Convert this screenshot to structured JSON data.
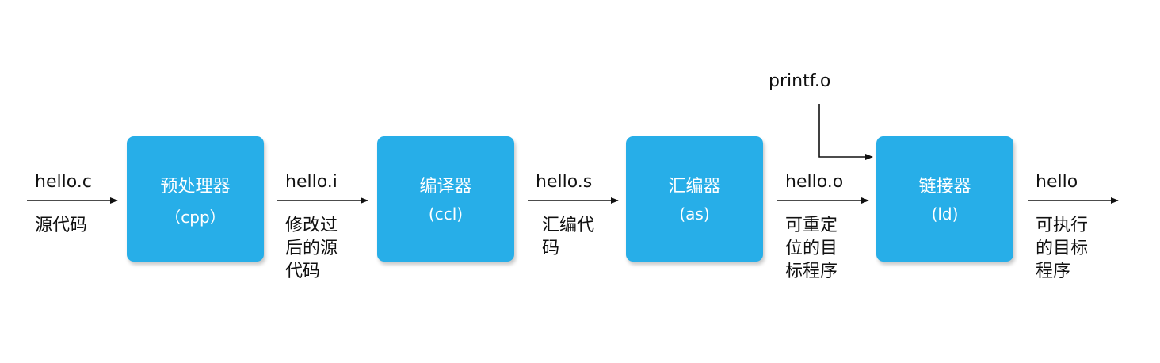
{
  "stages": [
    {
      "name": "预处理器",
      "tool": "（cpp）"
    },
    {
      "name": "编译器",
      "tool": "(ccl)"
    },
    {
      "name": "汇编器",
      "tool": "(as)"
    },
    {
      "name": "链接器",
      "tool": "(ld)"
    }
  ],
  "files": [
    {
      "name": "hello.c",
      "desc": "源代码"
    },
    {
      "name": "hello.i",
      "desc": "修改过\n后的源\n代码"
    },
    {
      "name": "hello.s",
      "desc": "汇编代\n码"
    },
    {
      "name": "hello.o",
      "desc": "可重定\n位的目\n标程序"
    },
    {
      "name": "hello",
      "desc": "可执行\n的目标\n程序"
    }
  ],
  "linker_input": {
    "name": "printf.o"
  },
  "colors": {
    "box": "#27aee8",
    "box_text": "#ffffff",
    "arrow": "#111111"
  }
}
